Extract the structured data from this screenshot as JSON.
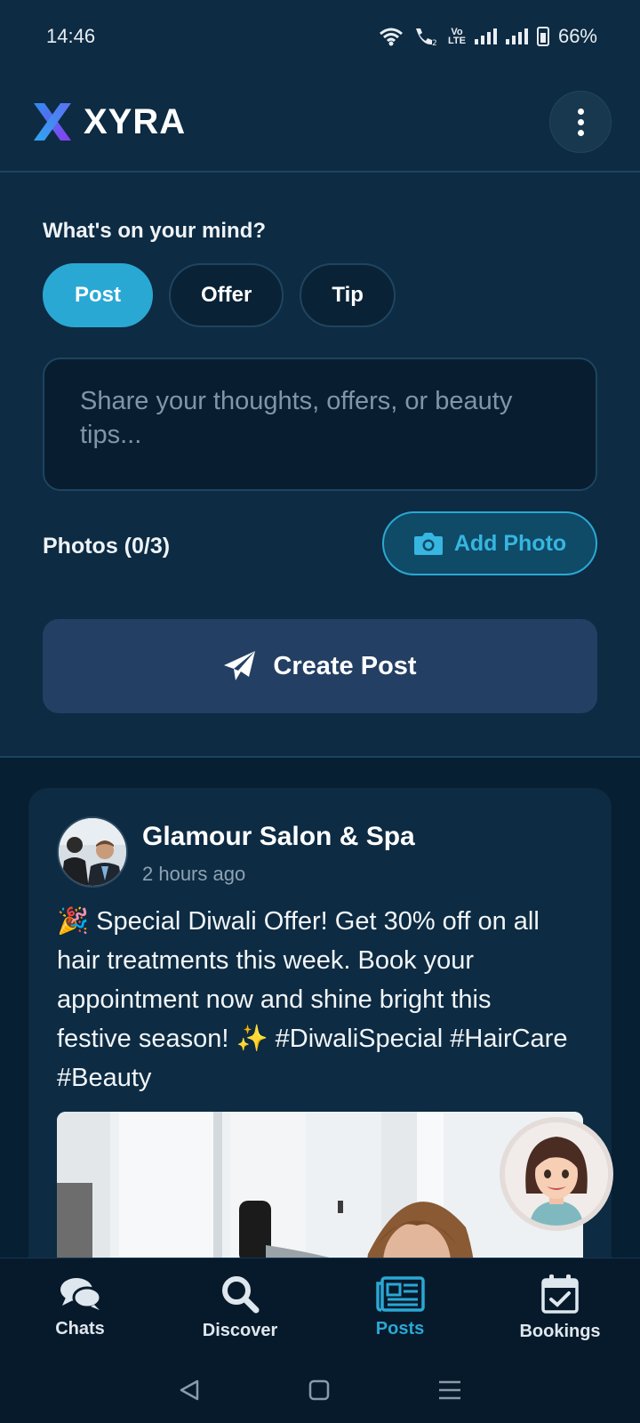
{
  "status_bar": {
    "time": "14:46",
    "battery": "66%"
  },
  "header": {
    "brand": "XYRA"
  },
  "composer": {
    "prompt": "What's on your mind?",
    "types": [
      "Post",
      "Offer",
      "Tip"
    ],
    "active_type": "Post",
    "placeholder": "Share your thoughts, offers, or beauty tips...",
    "photos_label": "Photos (0/3)",
    "add_photo_label": "Add Photo",
    "create_post_label": "Create Post"
  },
  "post": {
    "author": "Glamour Salon & Spa",
    "time": "2 hours ago",
    "text": "🎉 Special Diwali Offer! Get 30% off on all hair treatments this week. Book your appointment now and shine bright this festive season! ✨ #DiwaliSpecial #HairCare #Beauty"
  },
  "bottom_nav": {
    "items": [
      {
        "label": "Chats",
        "icon": "chat-bubbles-icon"
      },
      {
        "label": "Discover",
        "icon": "search-icon"
      },
      {
        "label": "Posts",
        "icon": "newspaper-icon"
      },
      {
        "label": "Bookings",
        "icon": "calendar-check-icon"
      }
    ],
    "active": "Posts"
  },
  "colors": {
    "accent": "#2aa8d4",
    "background": "#071f33",
    "surface": "#0d2b42",
    "create_button": "#233f63"
  }
}
